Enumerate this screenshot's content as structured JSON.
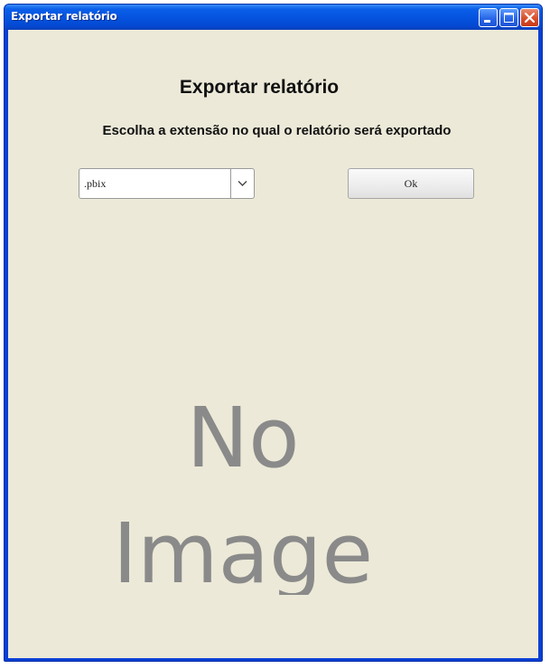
{
  "window": {
    "title": "Exportar relatório"
  },
  "main": {
    "heading": "Exportar relatório",
    "subheading": "Escolha a extensão no qual o relatório será exportado",
    "extension_select": {
      "value": ".pbix"
    },
    "ok_label": "Ok",
    "placeholder_image": {
      "line1": "No",
      "line2": "Image"
    }
  },
  "colors": {
    "titlebar": "#0554e0",
    "client_bg": "#ece9d8",
    "close_button": "#d84e2a",
    "placeholder_text": "#8a8a8a"
  }
}
